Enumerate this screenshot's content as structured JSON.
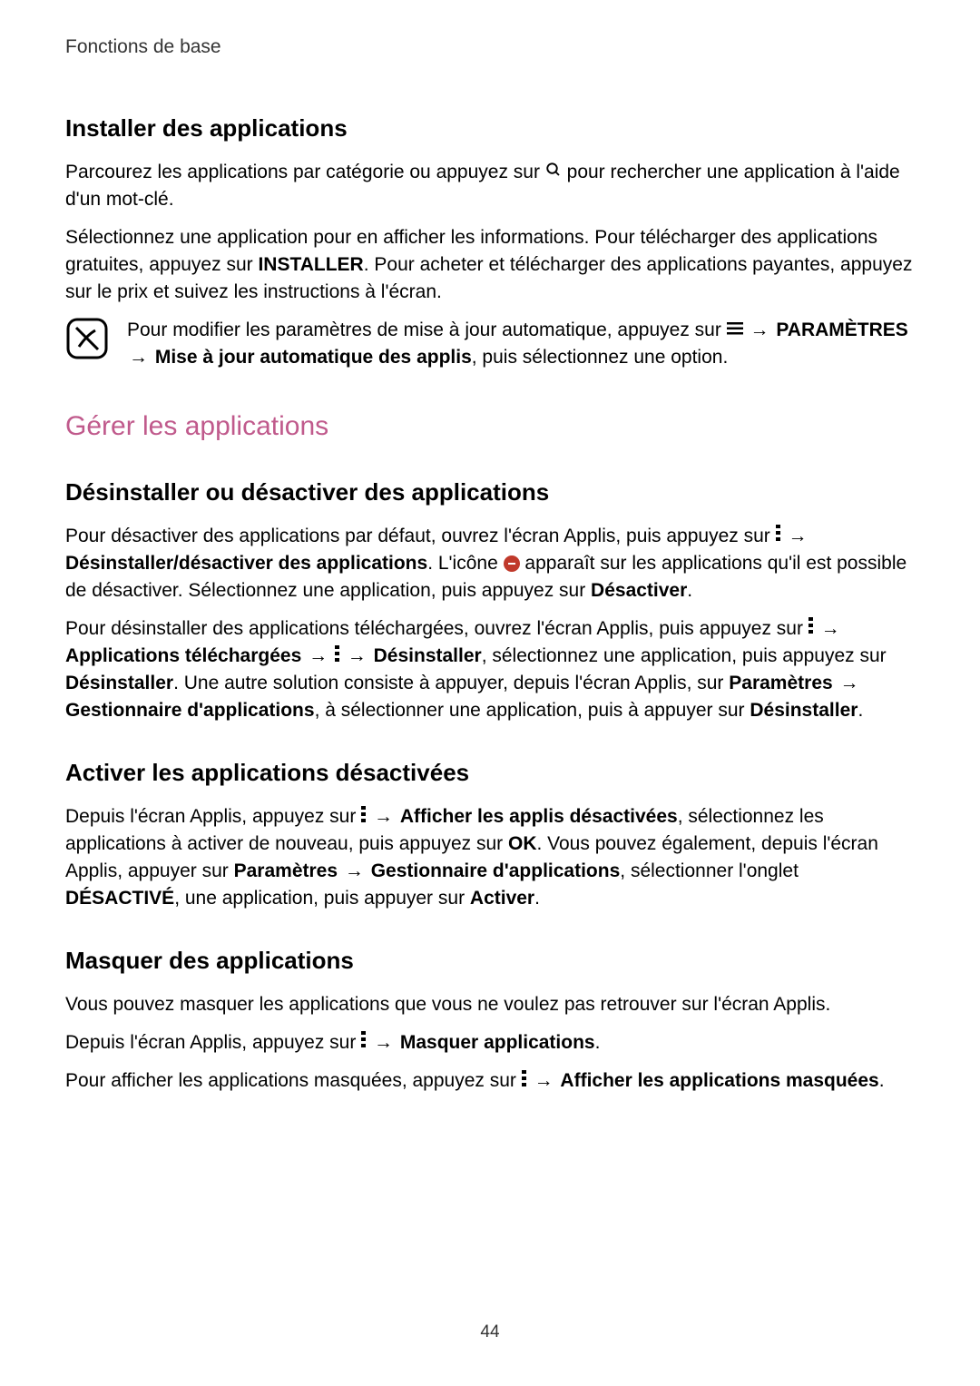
{
  "header": {
    "breadcrumb": "Fonctions de base"
  },
  "installer": {
    "heading": "Installer des applications",
    "p1a": "Parcourez les applications par catégorie ou appuyez sur ",
    "p1b": " pour rechercher une application à l'aide d'un mot-clé.",
    "p2a": "Sélectionnez une application pour en afficher les informations. Pour télécharger des applications gratuites, appuyez sur ",
    "p2_install": "INSTALLER",
    "p2b": ". Pour acheter et télécharger des applications payantes, appuyez sur le prix et suivez les instructions à l'écran.",
    "note_a": "Pour modifier les paramètres de mise à jour automatique, appuyez sur ",
    "note_arrow": "→",
    "note_settings": "PARAMÈTRES",
    "note_arrow2": "→",
    "note_autoupdate": "Mise à jour automatique des applis",
    "note_b": ", puis sélectionnez une option."
  },
  "gerer": {
    "heading": "Gérer les applications"
  },
  "desinstaller": {
    "heading": "Désinstaller ou désactiver des applications",
    "p1a": "Pour désactiver des applications par défaut, ouvrez l'écran Applis, puis appuyez sur ",
    "arrow": "→",
    "p1_label": "Désinstaller/désactiver des applications",
    "p1b": ". L'icône ",
    "p1c": " apparaît sur les applications qu'il est possible de désactiver. Sélectionnez une application, puis appuyez sur ",
    "p1_deactivate": "Désactiver",
    "p1d": ".",
    "p2a": "Pour désinstaller des applications téléchargées, ouvrez l'écran Applis, puis appuyez sur ",
    "p2_downloaded": "Applications téléchargées",
    "p2_uninstall": "Désinstaller",
    "p2b": ", sélectionnez une application, puis appuyez sur ",
    "p2_uninstall2": "Désinstaller",
    "p2c": ". Une autre solution consiste à appuyer, depuis l'écran Applis, sur ",
    "p2_params": "Paramètres",
    "p2_gestion": "Gestionnaire d'applications",
    "p2d": ", à sélectionner une application, puis à appuyer sur ",
    "p2_uninstall3": "Désinstaller",
    "p2e": "."
  },
  "activer": {
    "heading": "Activer les applications désactivées",
    "p1a": "Depuis l'écran Applis, appuyez sur ",
    "arrow": "→",
    "p1_label": "Afficher les applis désactivées",
    "p1b": ", sélectionnez les applications à activer de nouveau, puis appuyez sur ",
    "p1_ok": "OK",
    "p1c": ". Vous pouvez également, depuis l'écran Applis, appuyer sur ",
    "p1_params": "Paramètres",
    "p1_gestion": "Gestionnaire d'applications",
    "p1d": ", sélectionner l'onglet ",
    "p1_disabled": "DÉSACTIVÉ",
    "p1e": ", une application, puis appuyer sur ",
    "p1_activate": "Activer",
    "p1f": "."
  },
  "masquer": {
    "heading": "Masquer des applications",
    "p1": "Vous pouvez masquer les applications que vous ne voulez pas retrouver sur l'écran Applis.",
    "p2a": "Depuis l'écran Applis, appuyez sur ",
    "arrow": "→",
    "p2_label": "Masquer applications",
    "p2b": ".",
    "p3a": "Pour afficher les applications masquées, appuyez sur ",
    "p3_label": "Afficher les applications masquées",
    "p3b": "."
  },
  "footer": {
    "page_number": "44"
  }
}
